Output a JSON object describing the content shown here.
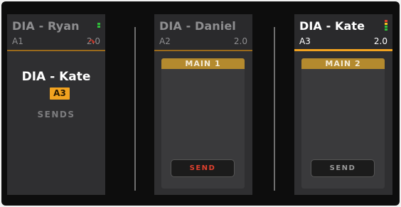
{
  "panels": [
    {
      "name": "DIA - Ryan",
      "code": "A1",
      "format": "2.0",
      "selected_name": "DIA - Kate",
      "selected_badge": "A3",
      "sends_label": "SENDS"
    },
    {
      "name": "DIA - Daniel",
      "code": "A2",
      "format": "2.0",
      "destination": "MAIN 1",
      "send_label": "SEND",
      "send_active": true
    },
    {
      "name": "DIA - Kate",
      "code": "A3",
      "format": "2.0",
      "destination": "MAIN 2",
      "send_label": "SEND",
      "send_active": false
    }
  ],
  "colors": {
    "accent": "#f2a320",
    "send_active": "#e0402e",
    "meter_green": "#2fbf3a",
    "meter_yellow": "#f2c31e",
    "meter_red": "#e0402e"
  }
}
